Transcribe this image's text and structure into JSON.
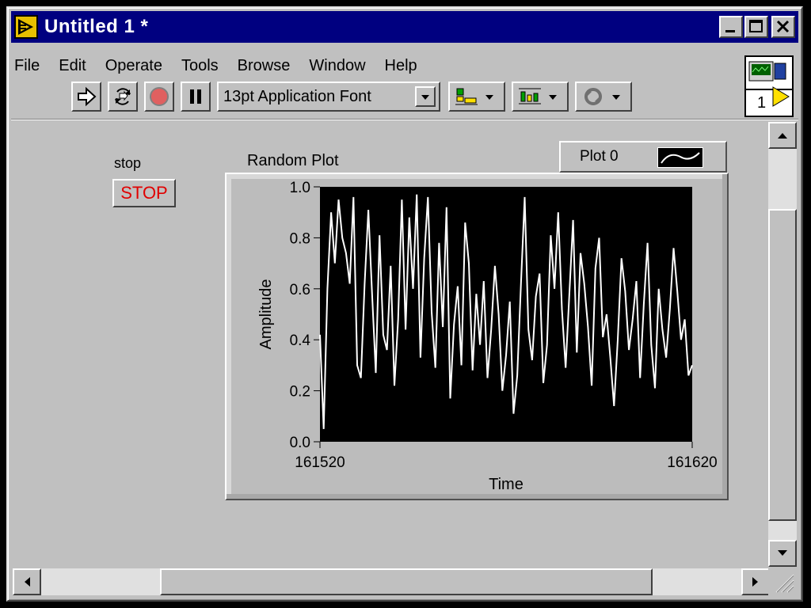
{
  "window": {
    "title": "Untitled 1 *"
  },
  "menu": [
    "File",
    "Edit",
    "Operate",
    "Tools",
    "Browse",
    "Window",
    "Help"
  ],
  "toolbar": {
    "font_select_value": "13pt Application Font"
  },
  "vi_icon": {
    "label": "1"
  },
  "stop_control": {
    "label": "stop",
    "button_text": "STOP",
    "text_color": "#e00000"
  },
  "chart_data": {
    "type": "line",
    "title": "Random Plot",
    "xlabel": "Time",
    "ylabel": "Amplitude",
    "xlim": [
      161520,
      161620
    ],
    "ylim": [
      0.0,
      1.0
    ],
    "x_ticks": [
      "161520",
      "161620"
    ],
    "y_ticks": [
      "0.0",
      "0.2",
      "0.4",
      "0.6",
      "0.8",
      "1.0"
    ],
    "grid": false,
    "legend_placement": "top-right",
    "plot_background": "#000000",
    "series": [
      {
        "name": "Plot 0",
        "color": "#ffffff",
        "x_start": 161520,
        "x_step": 1,
        "values": [
          0.42,
          0.05,
          0.6,
          0.9,
          0.7,
          0.95,
          0.8,
          0.74,
          0.62,
          0.96,
          0.3,
          0.25,
          0.62,
          0.91,
          0.58,
          0.27,
          0.81,
          0.42,
          0.36,
          0.69,
          0.22,
          0.48,
          0.95,
          0.44,
          0.88,
          0.6,
          0.97,
          0.33,
          0.72,
          0.96,
          0.51,
          0.29,
          0.78,
          0.45,
          0.92,
          0.17,
          0.46,
          0.61,
          0.3,
          0.86,
          0.7,
          0.28,
          0.58,
          0.38,
          0.63,
          0.25,
          0.44,
          0.69,
          0.5,
          0.2,
          0.34,
          0.55,
          0.11,
          0.26,
          0.62,
          0.96,
          0.44,
          0.32,
          0.57,
          0.66,
          0.23,
          0.38,
          0.81,
          0.6,
          0.9,
          0.52,
          0.29,
          0.58,
          0.87,
          0.35,
          0.74,
          0.62,
          0.45,
          0.22,
          0.68,
          0.8,
          0.41,
          0.5,
          0.33,
          0.14,
          0.4,
          0.72,
          0.59,
          0.36,
          0.48,
          0.63,
          0.25,
          0.54,
          0.78,
          0.38,
          0.21,
          0.6,
          0.44,
          0.33,
          0.52,
          0.76,
          0.59,
          0.4,
          0.48,
          0.26,
          0.3
        ]
      }
    ]
  }
}
